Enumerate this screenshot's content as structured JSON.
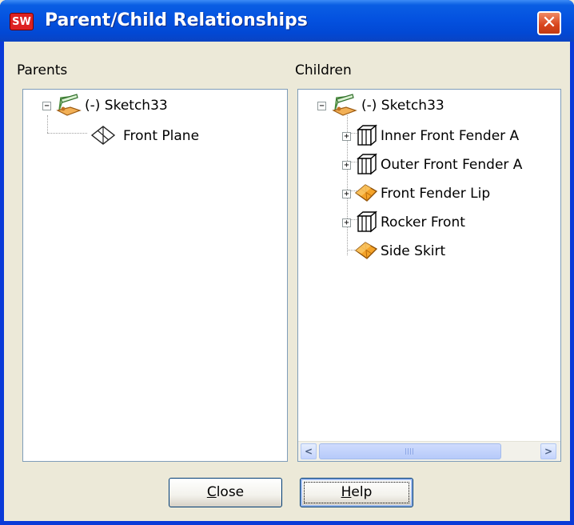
{
  "window": {
    "title": "Parent/Child Relationships",
    "app_icon_text": "SW"
  },
  "parents": {
    "label": "Parents",
    "root": {
      "expander": "−",
      "label": "(-) Sketch33",
      "icon": "sketch-icon"
    },
    "children": [
      {
        "label": "Front Plane",
        "icon": "plane-icon"
      }
    ]
  },
  "children": {
    "label": "Children",
    "root": {
      "expander": "−",
      "label": "(-) Sketch33",
      "icon": "sketch-icon"
    },
    "items": [
      {
        "label": "Inner Front Fender A",
        "icon": "extrude-feature-icon",
        "expandable": true
      },
      {
        "label": "Outer Front Fender A",
        "icon": "extrude-feature-icon",
        "expandable": true
      },
      {
        "label": "Front Fender Lip",
        "icon": "surface-feature-icon",
        "expandable": true
      },
      {
        "label": "Rocker Front",
        "icon": "extrude-feature-icon",
        "expandable": true
      },
      {
        "label": "Side Skirt",
        "icon": "surface-feature-icon",
        "expandable": false
      }
    ],
    "expander": "+"
  },
  "buttons": {
    "close": {
      "mnemonic": "C",
      "rest": "lose"
    },
    "help": {
      "mnemonic": "H",
      "rest": "elp"
    }
  },
  "colors": {
    "title_bar": "#0452e0",
    "dialog_bg": "#ece9d8",
    "pane_border": "#7f9db9"
  }
}
